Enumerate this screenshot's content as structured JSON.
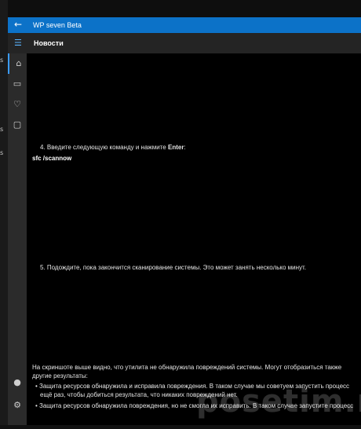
{
  "window": {
    "title": "WP seven Beta"
  },
  "header": {
    "title": "Новости"
  },
  "sidebar": {
    "items": [
      {
        "name": "home-icon",
        "glyph": "⌂"
      },
      {
        "name": "comment-icon",
        "glyph": "▭"
      },
      {
        "name": "heart-icon",
        "glyph": "♡"
      },
      {
        "name": "message-icon",
        "glyph": "▢"
      }
    ],
    "bottom": [
      {
        "name": "avatar",
        "glyph": "●"
      },
      {
        "name": "settings-icon",
        "glyph": "⚙"
      }
    ]
  },
  "article": {
    "step4_prefix": "4. Введите следующую команду и нажмите ",
    "step4_key": "Enter",
    "step4_suffix": ":",
    "command": "sfc /scannow",
    "step5": "5. Подождите, пока закончится сканирование системы. Это может занять несколько минут.",
    "summary_line1": "На скриншоте выше видно, что утилита не обнаружила повреждений системы. Могут отобразиться также",
    "summary_line2": "другие результаты:",
    "bullet1_line1": "• Защита ресурсов обнаружила и исправила повреждения. В таком случае мы советуем запустить процесс",
    "bullet1_line2": "ещё раз, чтобы добиться результата, что никаких повреждений нет.",
    "bullet2": "• Защита ресурсов обнаружила повреждения, но не смогла их исправить. В таком случае запустите процесс"
  },
  "watermark": "posetim.ru"
}
